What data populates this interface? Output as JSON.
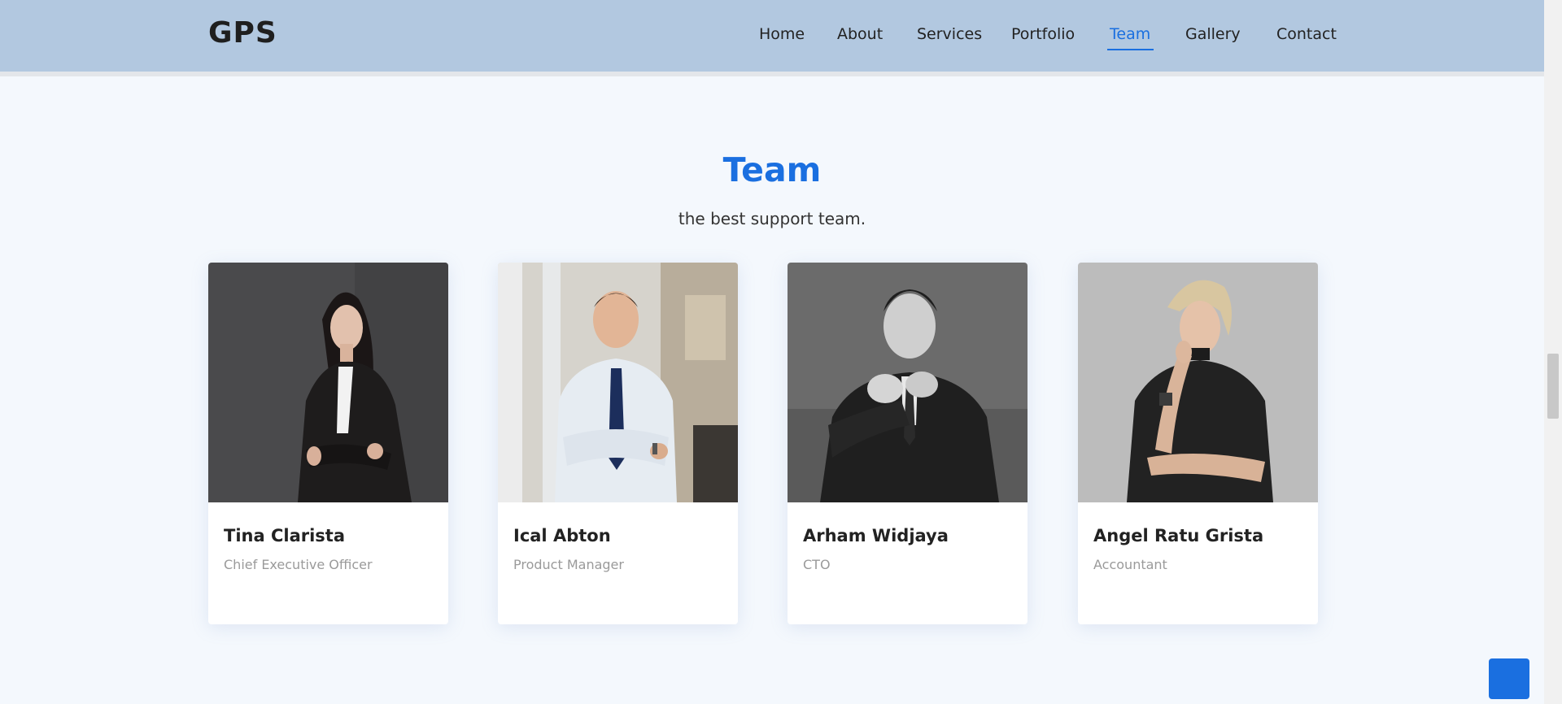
{
  "brand": {
    "logo": "GPS"
  },
  "nav": {
    "items": [
      {
        "label": "Home"
      },
      {
        "label": "About"
      },
      {
        "label": "Services"
      },
      {
        "label": "Portfolio"
      },
      {
        "label": "Team",
        "active": true
      },
      {
        "label": "Gallery"
      },
      {
        "label": "Contact"
      }
    ]
  },
  "team": {
    "title": "Team",
    "subtitle": "the best support team.",
    "members": [
      {
        "name": "Tina Clarista",
        "role": "Chief Executive Officer",
        "photo": "woman-portrait-photo"
      },
      {
        "name": "Ical Abton",
        "role": "Product Manager",
        "photo": "man-portrait-photo"
      },
      {
        "name": "Arham Widjaya",
        "role": "CTO",
        "photo": "man-portrait-photo"
      },
      {
        "name": "Angel Ratu Grista",
        "role": "Accountant",
        "photo": "woman-portrait-photo"
      }
    ]
  },
  "colors": {
    "header_bg": "#b2c8e0",
    "accent": "#1a6fe0",
    "page_bg": "#f4f8fd"
  },
  "icons": {
    "back_to_top": "arrow-up-icon"
  }
}
